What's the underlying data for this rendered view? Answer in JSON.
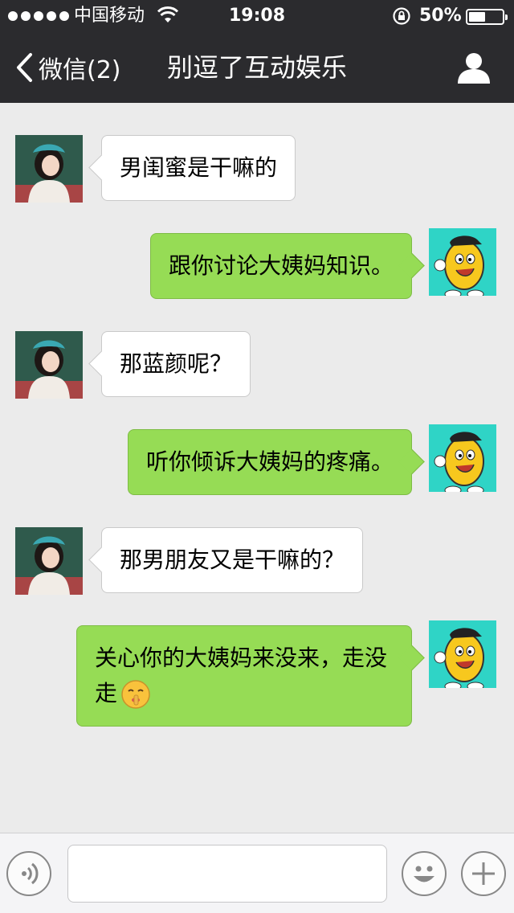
{
  "status_bar": {
    "carrier": "中国移动",
    "time": "19:08",
    "battery_percent": "50%",
    "battery_level": 0.5,
    "signal_dots": 5
  },
  "nav": {
    "back_label": "微信(2)",
    "title": "别逗了互动娱乐"
  },
  "messages": [
    {
      "side": "left",
      "text": "男闺蜜是干嘛的",
      "avatar": "girl-avatar"
    },
    {
      "side": "right",
      "text": "跟你讨论大姨妈知识。",
      "avatar": "mascot-avatar"
    },
    {
      "side": "left",
      "text": "那蓝颜呢？",
      "avatar": "girl-avatar"
    },
    {
      "side": "right",
      "text": "听你倾诉大姨妈的疼痛。",
      "avatar": "mascot-avatar"
    },
    {
      "side": "left",
      "text": "那男朋友又是干嘛的？",
      "avatar": "girl-avatar"
    },
    {
      "side": "right",
      "text_line1": "关心你的大姨妈来没来，走没",
      "text_line2": "走",
      "emoji": "shushing-face-emoji",
      "avatar": "mascot-avatar"
    }
  ],
  "input_bar": {
    "placeholder": "",
    "icons": [
      "voice-icon",
      "emoji-icon",
      "plus-icon"
    ]
  },
  "colors": {
    "nav_bg": "#2b2b2e",
    "chat_bg": "#ebebeb",
    "outgoing_bubble": "#96dc55",
    "incoming_bubble": "#ffffff"
  }
}
